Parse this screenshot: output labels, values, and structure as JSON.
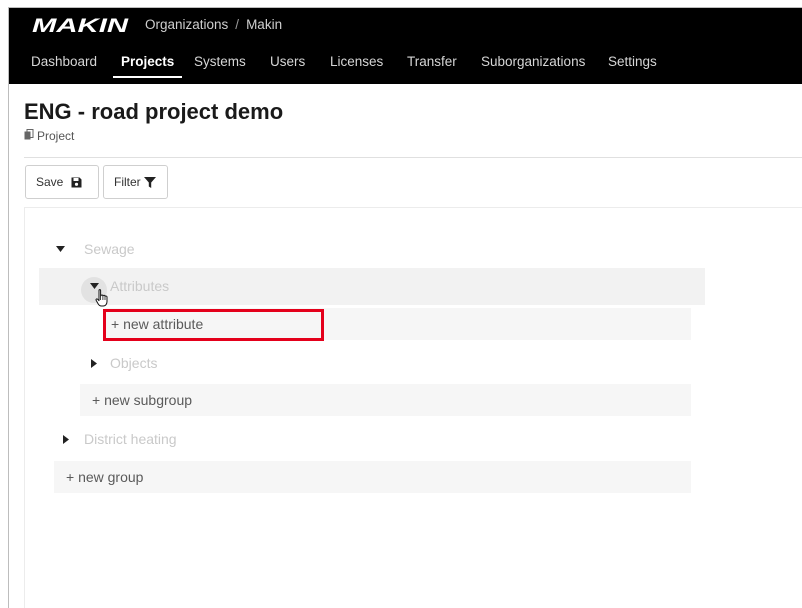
{
  "header": {
    "logo_text": "MAKIN",
    "breadcrumb": [
      "Organizations",
      "Makin"
    ],
    "breadcrumb_separator": "/"
  },
  "nav": {
    "items": [
      "Dashboard",
      "Projects",
      "Systems",
      "Users",
      "Licenses",
      "Transfer",
      "Suborganizations",
      "Settings"
    ],
    "active": "Projects"
  },
  "page": {
    "title": "ENG - road project demo",
    "subtitle": "Project"
  },
  "toolbar": {
    "save_label": "Save",
    "filter_label": "Filter"
  },
  "tree": {
    "group_sewage": "Sewage",
    "subgroup_attributes": "Attributes",
    "new_attribute": "+ new attribute",
    "subgroup_objects": "Objects",
    "new_subgroup": "+ new subgroup",
    "group_district_heating": "District heating",
    "new_group": "+ new group"
  },
  "icons": {
    "save": "floppy-disk-icon",
    "filter": "funnel-icon",
    "subtitle": "document-icon",
    "expanded": "caret-down-icon",
    "collapsed": "caret-right-icon",
    "cursor": "hand-pointer-icon"
  },
  "colors": {
    "header_bg": "#000000",
    "highlight": "#e4001b"
  }
}
